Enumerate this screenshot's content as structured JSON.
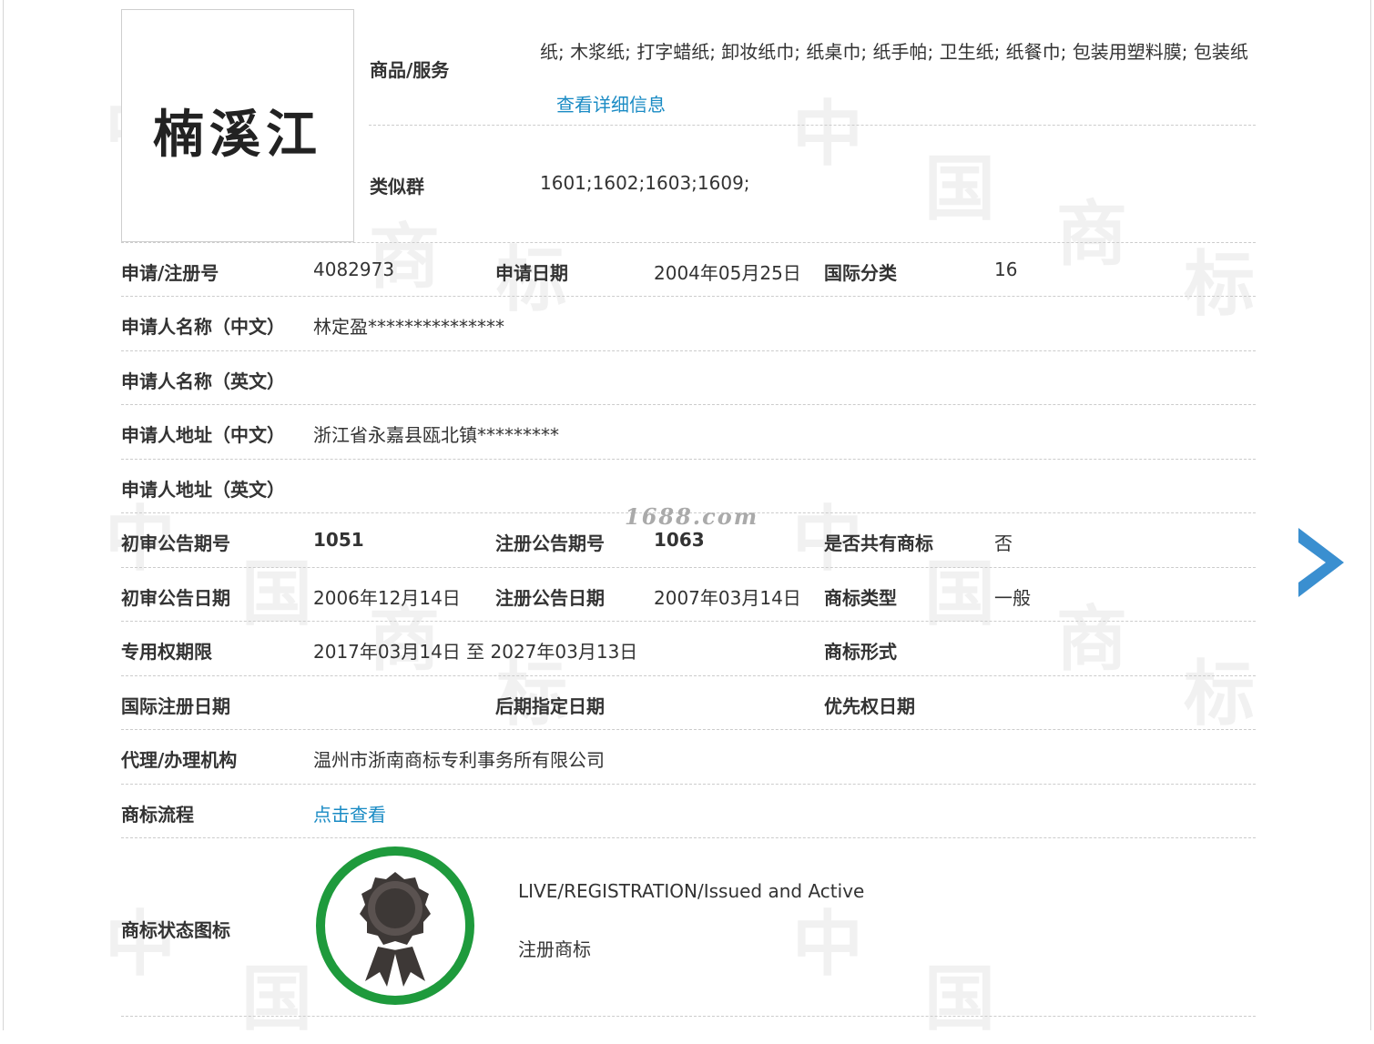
{
  "logo": {
    "text": "楠溪江"
  },
  "goods": {
    "label": "商品/服务",
    "text": "纸; 木浆纸; 打字蜡纸; 卸妆纸巾; 纸桌巾; 纸手帕; 卫生纸; 纸餐巾; 包装用塑料膜; 包装纸",
    "detail_link": "查看详细信息"
  },
  "similar_group": {
    "label": "类似群",
    "value": "1601;1602;1603;1609;"
  },
  "watermark": {
    "site": "1688.com",
    "chars": [
      "中",
      "国",
      "商",
      "标"
    ]
  },
  "fields": {
    "reg_no": {
      "label": "申请/注册号",
      "value": "4082973"
    },
    "apply_date": {
      "label": "申请日期",
      "value": "2004年05月25日"
    },
    "intl_class": {
      "label": "国际分类",
      "value": "16"
    },
    "applicant_cn": {
      "label": "申请人名称（中文）",
      "value": "林定盈***************"
    },
    "applicant_en": {
      "label": "申请人名称（英文）",
      "value": ""
    },
    "address_cn": {
      "label": "申请人地址（中文）",
      "value": "浙江省永嘉县瓯北镇*********"
    },
    "address_en": {
      "label": "申请人地址（英文）",
      "value": ""
    },
    "prelim_issue": {
      "label": "初审公告期号",
      "value": "1051"
    },
    "reg_issue": {
      "label": "注册公告期号",
      "value": "1063"
    },
    "shared": {
      "label": "是否共有商标",
      "value": "否"
    },
    "prelim_date": {
      "label": "初审公告日期",
      "value": "2006年12月14日"
    },
    "reg_date": {
      "label": "注册公告日期",
      "value": "2007年03月14日"
    },
    "tm_type": {
      "label": "商标类型",
      "value": "一般"
    },
    "exclusive_period": {
      "label": "专用权期限",
      "value": "2017年03月14日 至 2027年03月13日"
    },
    "tm_form": {
      "label": "商标形式",
      "value": ""
    },
    "intl_reg_date": {
      "label": "国际注册日期",
      "value": ""
    },
    "later_date": {
      "label": "后期指定日期",
      "value": ""
    },
    "priority_date": {
      "label": "优先权日期",
      "value": ""
    },
    "agency": {
      "label": "代理/办理机构",
      "value": "温州市浙南商标专利事务所有限公司"
    },
    "process": {
      "label": "商标流程",
      "link": "点击查看"
    },
    "status_icon": {
      "label": "商标状态图标"
    }
  },
  "status": {
    "en": "LIVE/REGISTRATION/Issued and Active",
    "cn": "注册商标"
  },
  "colors": {
    "link": "#1a8bc4",
    "badge_ring": "#1e9a3c",
    "arrow": "#3a8fd0"
  }
}
